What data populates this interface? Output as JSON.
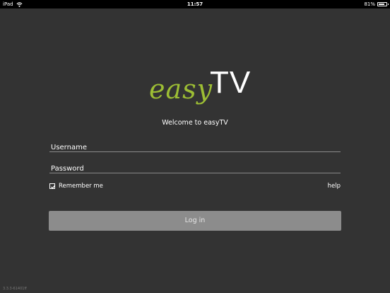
{
  "statusbar": {
    "device": "iPad",
    "time": "11:57",
    "battery_percent_text": "81%",
    "battery_level": 0.81
  },
  "logo": {
    "part_easy": "easy",
    "part_tv": "TV",
    "accent_color": "#9dbe34"
  },
  "welcome_text": "Welcome to easyTV",
  "form": {
    "username_placeholder": "Username",
    "password_placeholder": "Password",
    "remember_label": "Remember me",
    "remember_checked": true,
    "help_label": "help",
    "login_label": "Log in"
  },
  "version": "3.3.3-61401ff",
  "colors": {
    "background": "#333333",
    "button": "#8c8c8c"
  }
}
